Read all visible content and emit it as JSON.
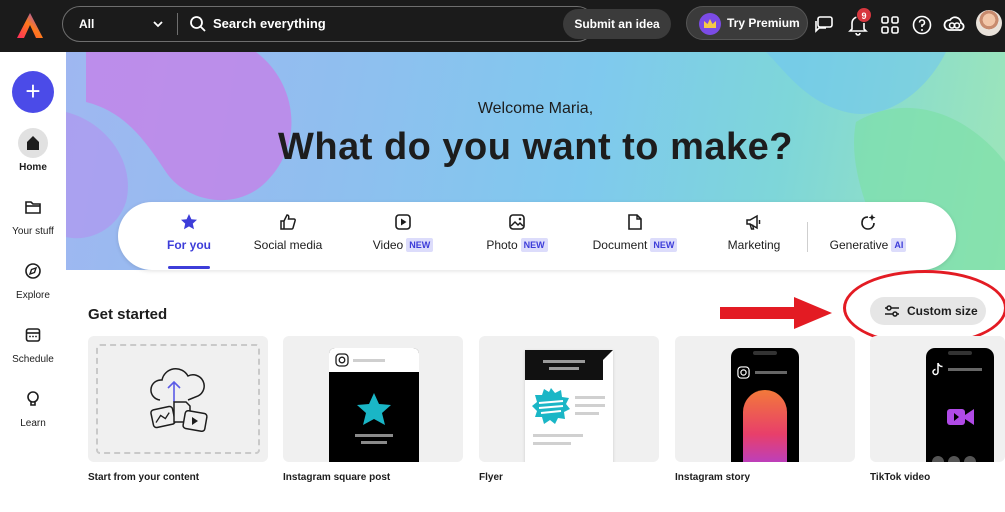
{
  "topbar": {
    "search_scope": "All",
    "search_placeholder": "Search everything",
    "submit_idea_label": "Submit an idea",
    "premium_label": "Try Premium",
    "notification_count": "9"
  },
  "sidebar": {
    "create_label": "+",
    "items": [
      {
        "label": "Home",
        "icon": "home-icon",
        "active": true
      },
      {
        "label": "Your stuff",
        "icon": "folder-icon",
        "active": false
      },
      {
        "label": "Explore",
        "icon": "compass-icon",
        "active": false
      },
      {
        "label": "Schedule",
        "icon": "calendar-icon",
        "active": false
      },
      {
        "label": "Learn",
        "icon": "lightbulb-icon",
        "active": false
      }
    ]
  },
  "hero": {
    "welcome": "Welcome Maria,",
    "headline": "What do you want to make?"
  },
  "tabs": [
    {
      "label": "For you",
      "icon": "star-icon",
      "tag": "",
      "active": true
    },
    {
      "label": "Social media",
      "icon": "thumbs-up-icon",
      "tag": ""
    },
    {
      "label": "Video",
      "icon": "play-icon",
      "tag": "NEW"
    },
    {
      "label": "Photo",
      "icon": "image-icon",
      "tag": "NEW"
    },
    {
      "label": "Document",
      "icon": "document-icon",
      "tag": "NEW"
    },
    {
      "label": "Marketing",
      "icon": "megaphone-icon",
      "tag": ""
    },
    {
      "label": "Generative",
      "icon": "sparkle-icon",
      "tag": "AI"
    }
  ],
  "get_started": {
    "title": "Get started",
    "custom_size_label": "Custom size",
    "cards": [
      {
        "label": "Start from your content"
      },
      {
        "label": "Instagram square post"
      },
      {
        "label": "Flyer"
      },
      {
        "label": "Instagram story"
      },
      {
        "label": "TikTok video"
      }
    ]
  },
  "colors": {
    "accent": "#3d3dd9",
    "create_button": "#4b4be8",
    "annotation_red": "#e31b23",
    "topbar": "#1b1b1b"
  }
}
